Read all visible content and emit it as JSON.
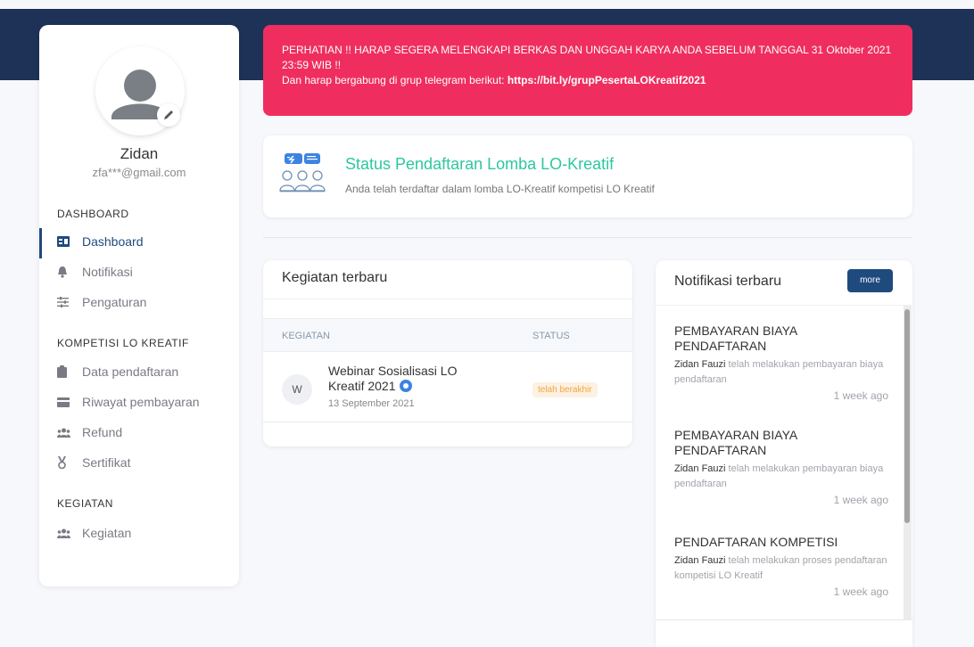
{
  "profile": {
    "name": "Zidan",
    "email": "zfa***@gmail.com"
  },
  "sidebar": {
    "sections": [
      {
        "heading": "DASHBOARD",
        "items": [
          {
            "label": "Dashboard",
            "icon": "dashboard-icon",
            "active": true
          },
          {
            "label": "Notifikasi",
            "icon": "bell-icon"
          },
          {
            "label": "Pengaturan",
            "icon": "sliders-icon"
          }
        ]
      },
      {
        "heading": "KOMPETISI LO KREATIF",
        "items": [
          {
            "label": "Data pendaftaran",
            "icon": "clipboard-icon"
          },
          {
            "label": "Riwayat pembayaran",
            "icon": "credit-card-icon"
          },
          {
            "label": "Refund",
            "icon": "users-icon"
          },
          {
            "label": "Sertifikat",
            "icon": "medal-icon"
          }
        ]
      },
      {
        "heading": "KEGIATAN",
        "items": [
          {
            "label": "Kegiatan",
            "icon": "users-icon"
          }
        ]
      }
    ]
  },
  "alert": {
    "line1": "PERHATIAN !! HARAP SEGERA MELENGKAPI BERKAS DAN UNGGAH KARYA ANDA SEBELUM TANGGAL 31 Oktober 2021 23:59 WIB !!",
    "line2_prefix": "Dan harap bergabung di grup telegram berikut: ",
    "link": "https://bit.ly/grupPesertaLOKreatif2021",
    "color": "#ef2e5f"
  },
  "status": {
    "title": "Status Pendaftaran Lomba LO-Kreatif",
    "description": "Anda telah terdaftar dalam lomba LO-Kreatif kompetisi LO Kreatif",
    "title_color": "#2dc7a0"
  },
  "activities": {
    "title": "Kegiatan terbaru",
    "columns": [
      "KEGIATAN",
      "STATUS"
    ],
    "rows": [
      {
        "avatar_letter": "W",
        "title": "Webinar Sosialisasi LO Kreatif 2021",
        "date": "13 September 2021",
        "status": "telah berakhir"
      }
    ]
  },
  "notifications": {
    "title": "Notifikasi terbaru",
    "more_label": "more",
    "items": [
      {
        "heading": "PEMBAYARAN BIAYA PENDAFTARAN",
        "actor": "Zidan Fauzi",
        "text": " telah melakukan pembayaran biaya pendaftaran",
        "time": "1 week ago"
      },
      {
        "heading": "PEMBAYARAN BIAYA PENDAFTARAN",
        "actor": "Zidan Fauzi",
        "text": " telah melakukan pembayaran biaya pendaftaran",
        "time": "1 week ago"
      },
      {
        "heading": "PENDAFTARAN KOMPETISI",
        "actor": "Zidan Fauzi",
        "text": " telah melakukan proses pendaftaran kompetisi LO Kreatif",
        "time": "1 week ago"
      }
    ]
  },
  "colors": {
    "primary": "#1f4a7e",
    "header_band": "#1e3257",
    "badge_text": "#f0a644"
  }
}
